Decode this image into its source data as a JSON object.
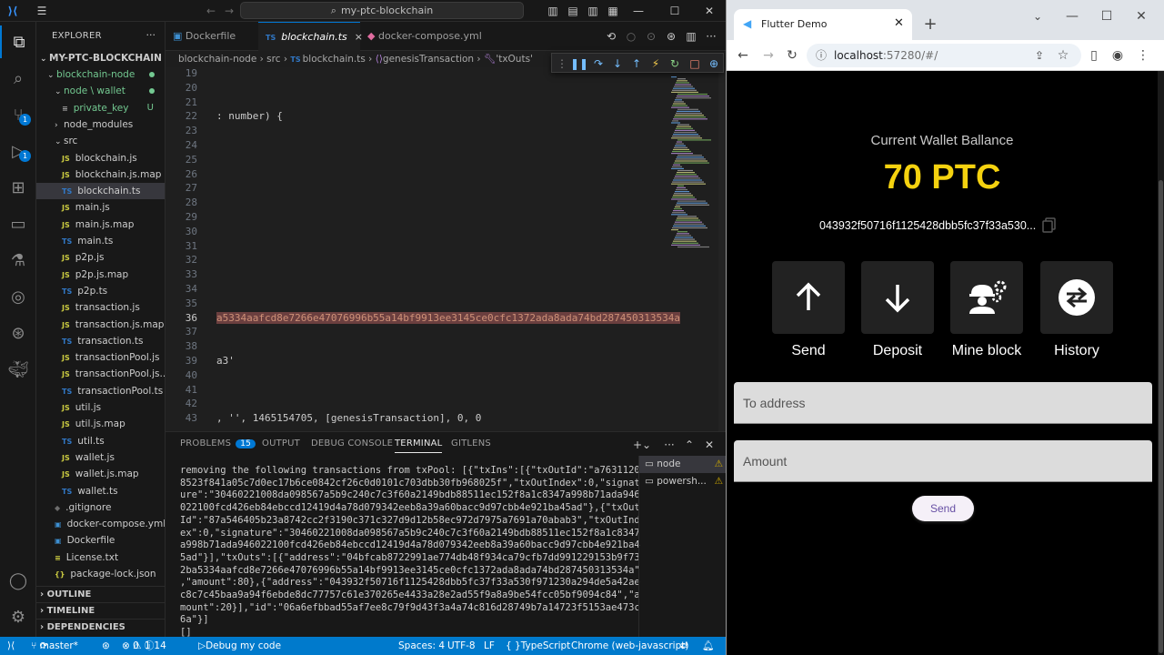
{
  "vscode": {
    "window_title": "my-ptc-blockchain",
    "explorer_title": "EXPLORER",
    "root_folder": "MY-PTC-BLOCKCHAIN",
    "tree": [
      {
        "label": "blockchain-node",
        "type": "folder-open",
        "indent": 1,
        "mark": "dot"
      },
      {
        "label": "node \\ wallet",
        "type": "folder-open",
        "indent": 2,
        "mark": "dot"
      },
      {
        "label": "private_key",
        "type": "file",
        "indent": 3,
        "mark": "U"
      },
      {
        "label": "node_modules",
        "type": "folder-closed",
        "indent": 2,
        "mark": ""
      },
      {
        "label": "src",
        "type": "folder-open",
        "indent": 2,
        "mark": ""
      },
      {
        "label": "blockchain.js",
        "type": "JS",
        "indent": 3,
        "mark": ""
      },
      {
        "label": "blockchain.js.map",
        "type": "JS",
        "indent": 3,
        "mark": ""
      },
      {
        "label": "blockchain.ts",
        "type": "TS",
        "indent": 3,
        "mark": "",
        "selected": true
      },
      {
        "label": "main.js",
        "type": "JS",
        "indent": 3,
        "mark": ""
      },
      {
        "label": "main.js.map",
        "type": "JS",
        "indent": 3,
        "mark": ""
      },
      {
        "label": "main.ts",
        "type": "TS",
        "indent": 3,
        "mark": ""
      },
      {
        "label": "p2p.js",
        "type": "JS",
        "indent": 3,
        "mark": ""
      },
      {
        "label": "p2p.js.map",
        "type": "JS",
        "indent": 3,
        "mark": ""
      },
      {
        "label": "p2p.ts",
        "type": "TS",
        "indent": 3,
        "mark": ""
      },
      {
        "label": "transaction.js",
        "type": "JS",
        "indent": 3,
        "mark": ""
      },
      {
        "label": "transaction.js.map",
        "type": "JS",
        "indent": 3,
        "mark": ""
      },
      {
        "label": "transaction.ts",
        "type": "TS",
        "indent": 3,
        "mark": ""
      },
      {
        "label": "transactionPool.js",
        "type": "JS",
        "indent": 3,
        "mark": ""
      },
      {
        "label": "transactionPool.js....",
        "type": "JS",
        "indent": 3,
        "mark": ""
      },
      {
        "label": "transactionPool.ts",
        "type": "TS",
        "indent": 3,
        "mark": ""
      },
      {
        "label": "util.js",
        "type": "JS",
        "indent": 3,
        "mark": ""
      },
      {
        "label": "util.js.map",
        "type": "JS",
        "indent": 3,
        "mark": ""
      },
      {
        "label": "util.ts",
        "type": "TS",
        "indent": 3,
        "mark": ""
      },
      {
        "label": "wallet.js",
        "type": "JS",
        "indent": 3,
        "mark": ""
      },
      {
        "label": "wallet.js.map",
        "type": "JS",
        "indent": 3,
        "mark": ""
      },
      {
        "label": "wallet.ts",
        "type": "TS",
        "indent": 3,
        "mark": ""
      },
      {
        "label": ".gitignore",
        "type": "git",
        "indent": 2,
        "mark": ""
      },
      {
        "label": "docker-compose.yml",
        "type": "docker",
        "indent": 2,
        "mark": ""
      },
      {
        "label": "Dockerfile",
        "type": "docker",
        "indent": 2,
        "mark": ""
      },
      {
        "label": "License.txt",
        "type": "txt",
        "indent": 2,
        "mark": ""
      },
      {
        "label": "package-lock.json",
        "type": "json",
        "indent": 2,
        "mark": ""
      }
    ],
    "sections": [
      "OUTLINE",
      "TIMELINE",
      "DEPENDENCIES"
    ],
    "tabs": [
      {
        "label": "Dockerfile",
        "icon": "docker"
      },
      {
        "label": "blockchain.ts",
        "icon": "TS",
        "active": true
      },
      {
        "label": "docker-compose.yml",
        "icon": "docker"
      }
    ],
    "breadcrumb": [
      "blockchain-node",
      "src",
      "blockchain.ts",
      "genesisTransaction",
      "'txOuts'"
    ],
    "code_lines": [
      {
        "num": "19",
        "text": ""
      },
      {
        "num": "20",
        "text": ""
      },
      {
        "num": "21",
        "text": ""
      },
      {
        "num": "22",
        "text": ": number) {"
      },
      {
        "num": "23",
        "text": ""
      },
      {
        "num": "24",
        "text": ""
      },
      {
        "num": "25",
        "text": ""
      },
      {
        "num": "26",
        "text": ""
      },
      {
        "num": "27",
        "text": ""
      },
      {
        "num": "28",
        "text": ""
      },
      {
        "num": "29",
        "text": ""
      },
      {
        "num": "30",
        "text": ""
      },
      {
        "num": "31",
        "text": ""
      },
      {
        "num": "32",
        "text": ""
      },
      {
        "num": "33",
        "text": ""
      },
      {
        "num": "34",
        "text": ""
      },
      {
        "num": "35",
        "text": ""
      },
      {
        "num": "36",
        "text": "a5334aafcd8e7266e47076996b55a14bf9913ee3145ce0cfc1372ada8ada74bd287450313534a",
        "highlight": true
      },
      {
        "num": "37",
        "text": ""
      },
      {
        "num": "38",
        "text": ""
      },
      {
        "num": "39",
        "text": "a3'"
      },
      {
        "num": "40",
        "text": ""
      },
      {
        "num": "41",
        "text": ""
      },
      {
        "num": "42",
        "text": ""
      },
      {
        "num": "43",
        "text": ", '', 1465154705, [genesisTransaction], 0, 0"
      }
    ],
    "panel_tabs": [
      {
        "label": "PROBLEMS",
        "badge": "15"
      },
      {
        "label": "OUTPUT"
      },
      {
        "label": "DEBUG CONSOLE"
      },
      {
        "label": "TERMINAL",
        "active": true
      },
      {
        "label": "GITLENS"
      }
    ],
    "terminal_lines": [
      "removing the following transactions from txPool: [{\"txIns\":[{\"txOutId\":\"a7631120",
      "8523f841a05c7d0ec17b6ce0842cf26c0d0101c703dbb30fb968025f\",\"txOutIndex\":0,\"signat",
      "ure\":\"30460221008da098567a5b9c240c7c3f60a2149bdb88511ec152f8a1c8347a998b71ada946",
      "022100fcd426eb84ebccd12419d4a78d079342eeb8a39a60bacc9d97cbb4e921ba45ad\"},{\"txOut",
      "Id\":\"87a546405b23a8742cc2f3190c371c327d9d12b58ec972d7975a7691a70abab3\",\"txOutInd",
      "ex\":0,\"signature\":\"30460221008da098567a5b9c240c7c3f60a2149bdb88511ec152f8a1c8347",
      "a998b71ada946022100fcd426eb84ebccd12419d4a78d079342eeb8a39a60bacc9d97cbb4e921ba4",
      "5ad\"}],\"txOuts\":[{\"address\":\"04bfcab8722991ae774db48f934ca79cfb7dd991229153b9f73",
      "2ba5334aafcd8e7266e47076996b55a14bf9913ee3145ce0cfc1372ada8ada74bd287450313534a\"",
      ",\"amount\":80},{\"address\":\"043932f50716f1125428dbb5fc37f33a530f971230a294de5a42ae",
      "c8c7c45baa9a94f6ebde8dc77757c61e370265e4433a28e2ad55f9a8a9be54fcc05bf9094c84\",\"a",
      "mount\":20}],\"id\":\"06a6efbbad55af7ee8c79f9d43f3a4a74c816d28749b7a14723f5153ae473c",
      "6a\"}]",
      "[]"
    ],
    "terminal_instances": [
      {
        "label": "node",
        "selected": true
      },
      {
        "label": "powersh...",
        "selected": false
      }
    ],
    "status": {
      "branch": "master*",
      "errors": "0",
      "warnings": "1",
      "infos": "14",
      "debug": "Debug my code",
      "spaces": "Spaces: 4",
      "encoding": "UTF-8",
      "eol": "LF",
      "language": "TypeScript",
      "target": "Chrome (web-javascript)"
    }
  },
  "chrome": {
    "tab_title": "Flutter Demo",
    "url_host": "localhost",
    "url_rest": ":57280/#/"
  },
  "app": {
    "balance_caption": "Current Wallet Ballance",
    "balance_value": "70 PTC",
    "address": "043932f50716f1125428dbb5fc37f33a530...",
    "actions": [
      {
        "label": "Send",
        "icon": "arrow-up-icon"
      },
      {
        "label": "Deposit",
        "icon": "arrow-down-icon"
      },
      {
        "label": "Mine block",
        "icon": "miner-gears-icon"
      },
      {
        "label": "History",
        "icon": "swap-arrows-icon"
      }
    ],
    "to_address_placeholder": "To address",
    "amount_placeholder": "Amount",
    "send_button": "Send",
    "accent": "#f5d20f"
  }
}
